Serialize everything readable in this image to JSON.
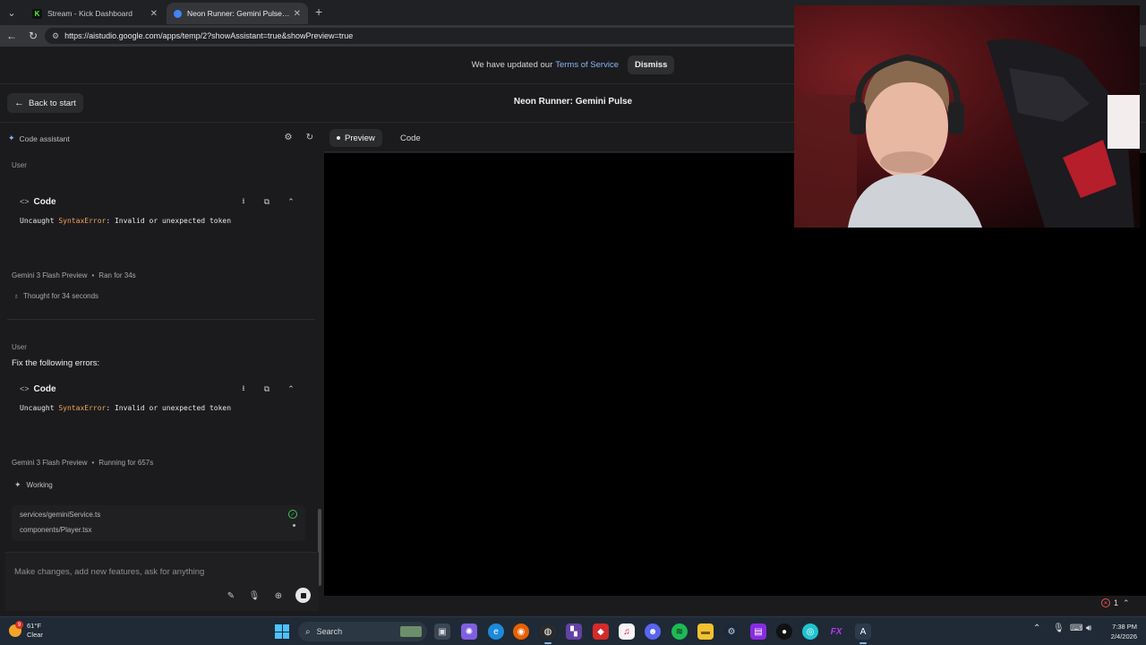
{
  "browser": {
    "tabs": [
      {
        "label": "Stream - Kick Dashboard",
        "favicon": "kick-icon"
      },
      {
        "label": "Neon Runner: Gemini Pulse | Google AI Studio",
        "favicon": "ai-studio-icon",
        "active": true
      }
    ],
    "url": "https://aistudio.google.com/apps/temp/2?showAssistant=true&showPreview=true"
  },
  "banner": {
    "text": "We have updated our",
    "link": "Terms of Service",
    "dismiss_label": "Dismiss"
  },
  "header": {
    "back_label": "Back to start",
    "title": "Neon Runner: Gemini Pulse"
  },
  "assistant": {
    "label": "Code assistant",
    "messages": {
      "first_user_label": "User",
      "code_title": "Code",
      "error_prefix": "Uncaught ",
      "error_name": "SyntaxError",
      "error_suffix": ": Invalid or unexpected token",
      "model_name_1": "Gemini 3 Flash Preview",
      "ran_for": "Ran for 34s",
      "thought": "Thought for 34 seconds",
      "second_user_label": "User",
      "second_user_text": "Fix the following errors:",
      "code_title_2": "Code",
      "model_name_2": "Gemini 3 Flash Preview",
      "running_for": "Running for 657s",
      "working": "Working",
      "files": [
        "services/geminiService.ts",
        "components/Player.tsx"
      ]
    },
    "composer_placeholder": "Make changes, add new features, ask for anything"
  },
  "preview": {
    "tabs": [
      "Preview",
      "Code"
    ],
    "error_count": "1"
  },
  "taskbar": {
    "weather_temp": "61°F",
    "weather_desc": "Clear",
    "notification_badge": "9",
    "search_label": "Search",
    "time": "7:38 PM",
    "date": "2/4/2026"
  },
  "colors": {
    "accent_link": "#8ab4f8",
    "error_token": "#f0a35a",
    "success": "#3ec45b",
    "error": "#e2554b"
  }
}
